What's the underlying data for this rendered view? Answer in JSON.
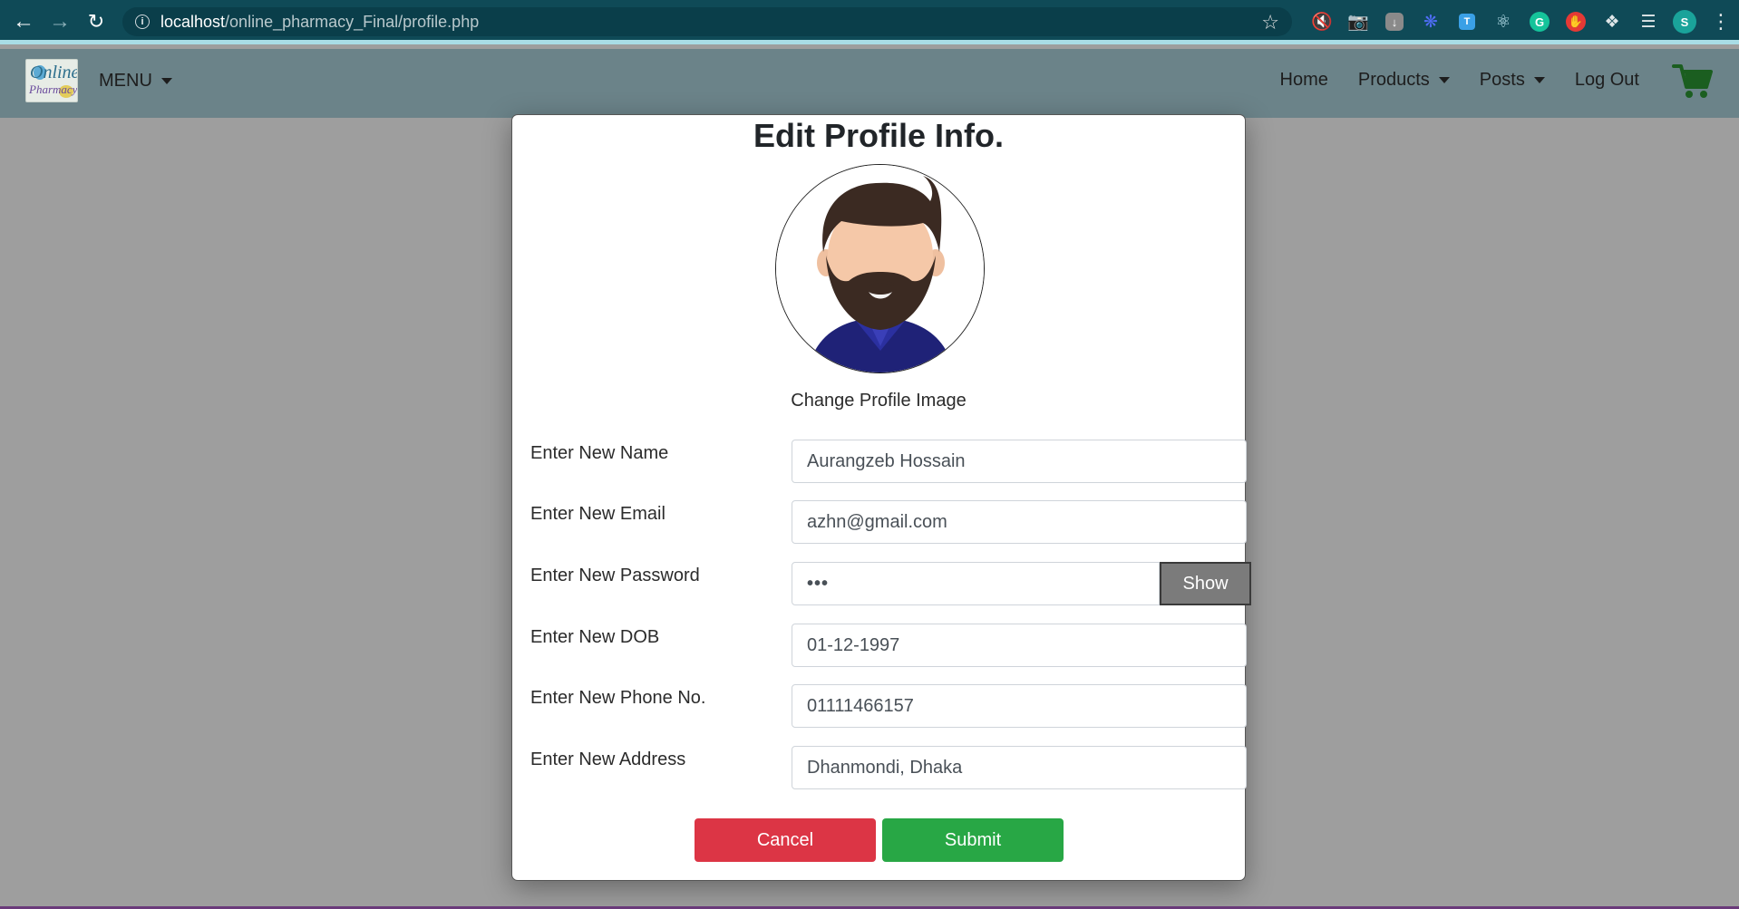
{
  "browser": {
    "url_host": "localhost",
    "url_path": "/online_pharmacy_Final/profile.php",
    "profile_initial": "S"
  },
  "navbar": {
    "logo_text_top": "Online",
    "logo_text_bottom": "Pharmacy",
    "menu_label": "MENU",
    "links": {
      "home": "Home",
      "products": "Products",
      "posts": "Posts",
      "logout": "Log Out"
    },
    "cart_color": "#1b5e20"
  },
  "modal": {
    "title": "Edit Profile Info.",
    "change_image_label": "Change Profile Image",
    "fields": {
      "name": {
        "label": "Enter New Name",
        "value": "Aurangzeb Hossain"
      },
      "email": {
        "label": "Enter New Email",
        "value": "azhn@gmail.com"
      },
      "password": {
        "label": "Enter New Password",
        "value": "•••",
        "show_label": "Show"
      },
      "dob": {
        "label": "Enter New DOB",
        "value": "01-12-1997"
      },
      "phone": {
        "label": "Enter New Phone No.",
        "value": "01111466157"
      },
      "address": {
        "label": "Enter New Address",
        "value": "Dhanmondi, Dhaka"
      }
    },
    "cancel_label": "Cancel",
    "submit_label": "Submit",
    "colors": {
      "cancel": "#dc3545",
      "submit": "#28a745"
    }
  }
}
